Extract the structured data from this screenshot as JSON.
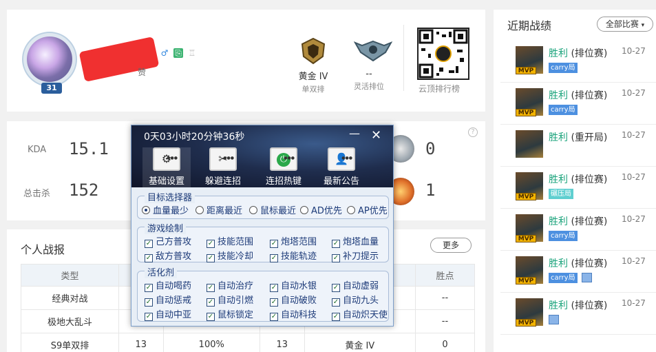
{
  "profile": {
    "level": "31",
    "likes_suffix": "赞",
    "ranks": [
      {
        "tier": "黄金 IV",
        "queue": "单双排"
      },
      {
        "tier": "--",
        "queue": "灵活排位"
      }
    ],
    "qr_label": "云顶排行榜",
    "icons": [
      "male-icon",
      "copy-icon",
      "trophy-icon"
    ]
  },
  "stats": {
    "kda_label": "KDA",
    "kda_value": "15.1",
    "kills_label": "总击杀",
    "kills_value": "152",
    "right_top": "0",
    "right_bottom": "1"
  },
  "report": {
    "title": "个人战报",
    "more": "更多",
    "columns": [
      "类型",
      "",
      "",
      "",
      "",
      "胜点"
    ],
    "rows": [
      [
        "经典对战",
        "",
        "",
        "",
        "",
        "--"
      ],
      [
        "极地大乱斗",
        "",
        "",
        "",
        "",
        "--"
      ],
      [
        "S9单双排",
        "13",
        "100%",
        "13",
        "黄金 IV",
        "0"
      ]
    ]
  },
  "recent": {
    "title": "近期战绩",
    "filter": "全部比赛",
    "items": [
      {
        "result": "胜利",
        "mode": "(排位赛)",
        "date": "10-27",
        "tag": "carry局",
        "mvp": "MVP"
      },
      {
        "result": "胜利",
        "mode": "(排位赛)",
        "date": "10-27",
        "tag": "carry局",
        "mvp": "MVP"
      },
      {
        "result": "胜利",
        "mode": "(重开局)",
        "date": "10-27",
        "tag": "",
        "mvp": ""
      },
      {
        "result": "胜利",
        "mode": "(排位赛)",
        "date": "10-27",
        "tag": "碾压局",
        "mvp": "MVP"
      },
      {
        "result": "胜利",
        "mode": "(排位赛)",
        "date": "10-27",
        "tag": "carry局",
        "mvp": "MVP"
      },
      {
        "result": "胜利",
        "mode": "(排位赛)",
        "date": "10-27",
        "tag": "carry局",
        "mvp": "MVP"
      },
      {
        "result": "胜利",
        "mode": "(排位赛)",
        "date": "10-27",
        "tag": "",
        "mvp": "MVP"
      }
    ]
  },
  "overlay": {
    "timer": "0天03小时20分钟36秒",
    "minimize": "—",
    "close": "✕",
    "tabs": [
      "基础设置",
      "躲避连招",
      "连招热键",
      "最新公告"
    ],
    "target_group": {
      "title": "目标选择器",
      "options": [
        "血量最少",
        "距离最近",
        "鼠标最近",
        "AD优先",
        "AP优先"
      ],
      "selected": "血量最少"
    },
    "draw_group": {
      "title": "游戏绘制",
      "options": [
        "己方普攻",
        "技能范围",
        "炮塔范围",
        "炮塔血量",
        "敌方普攻",
        "技能冷却",
        "技能轨迹",
        "补刀提示"
      ]
    },
    "activate_group": {
      "title": "活化剂",
      "options": [
        "自动喝药",
        "自动治疗",
        "自动水银",
        "自动虚弱",
        "自动惩戒",
        "自动引燃",
        "自动破败",
        "自动九头",
        "自动中亚",
        "鼠标锁定",
        "自动科技",
        "自动炽天使"
      ]
    }
  },
  "colors": {
    "accent": "#1aa37b",
    "tag_blue": "#4d90e0",
    "overlay_text": "#1c3a78"
  }
}
